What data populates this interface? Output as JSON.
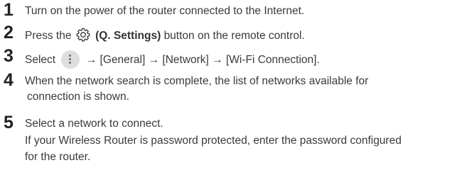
{
  "steps": [
    {
      "number": "1",
      "text": "Turn on the power of the router connected to the Internet."
    },
    {
      "number": "2",
      "text_before": "Press the",
      "icon": "gear-settings-icon",
      "bold": "(Q. Settings)",
      "text_after": "button on the remote control."
    },
    {
      "number": "3",
      "text_before": "Select",
      "icon": "more-options-icon",
      "text_after": "→ [General] → [Network] → [Wi-Fi Connection]."
    },
    {
      "number": "4",
      "line1": "When the network search is complete, the list of networks available for",
      "line2": "connection is shown."
    },
    {
      "number": "5",
      "line1": "Select a network to connect.",
      "line2": "If your Wireless Router is password protected, enter the password configured",
      "line3": "for the router."
    }
  ]
}
